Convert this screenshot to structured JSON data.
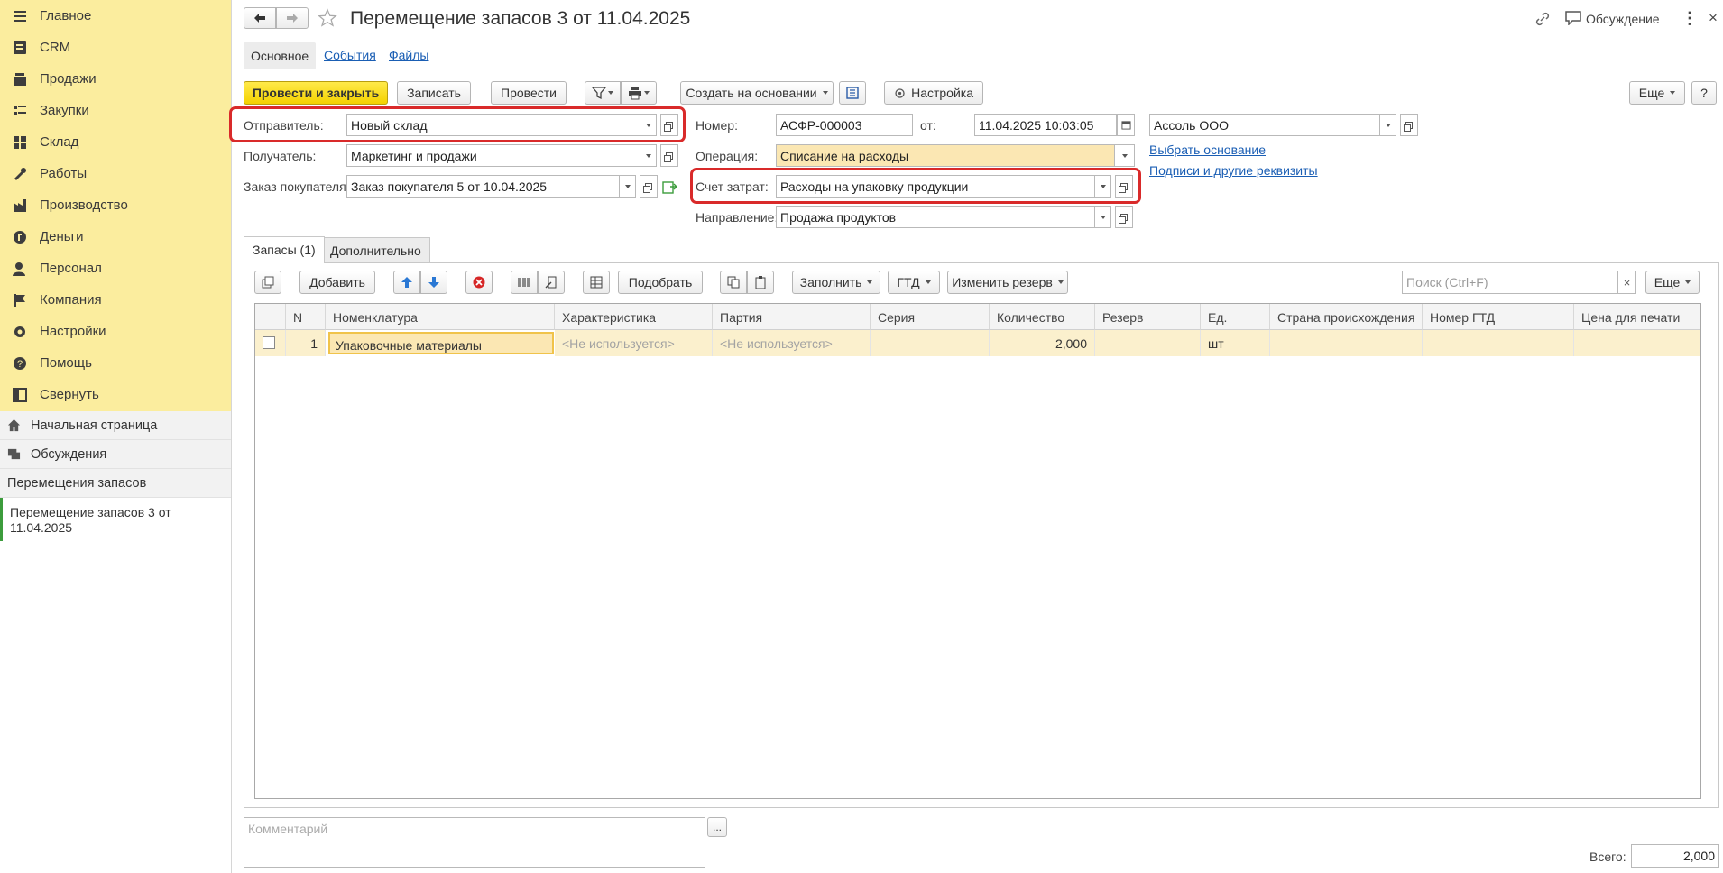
{
  "sidebar": {
    "menu": [
      {
        "label": "Главное",
        "icon": "hamburger-icon"
      },
      {
        "label": "CRM",
        "icon": "crm-icon"
      },
      {
        "label": "Продажи",
        "icon": "cart-icon"
      },
      {
        "label": "Закупки",
        "icon": "purchases-icon"
      },
      {
        "label": "Склад",
        "icon": "warehouse-icon"
      },
      {
        "label": "Работы",
        "icon": "tools-icon"
      },
      {
        "label": "Производство",
        "icon": "factory-icon"
      },
      {
        "label": "Деньги",
        "icon": "money-icon"
      },
      {
        "label": "Персонал",
        "icon": "person-icon"
      },
      {
        "label": "Компания",
        "icon": "flag-icon"
      },
      {
        "label": "Настройки",
        "icon": "gear-icon"
      },
      {
        "label": "Помощь",
        "icon": "help-icon"
      },
      {
        "label": "Свернуть",
        "icon": "collapse-icon"
      }
    ],
    "home": "Начальная страница",
    "discussions": "Обсуждения",
    "section": "Перемещения запасов",
    "current_doc": "Перемещение запасов 3 от 11.04.2025"
  },
  "header": {
    "title": "Перемещение запасов 3 от 11.04.2025",
    "discussion": "Обсуждение"
  },
  "tabs_top": [
    "Основное",
    "События",
    "Файлы"
  ],
  "toolbar": {
    "post_close": "Провести и закрыть",
    "save": "Записать",
    "post": "Провести",
    "create_based": "Создать на основании",
    "settings": "Настройка",
    "more": "Еще",
    "help": "?"
  },
  "form": {
    "sender_label": "Отправитель:",
    "sender": "Новый склад",
    "recipient_label": "Получатель:",
    "recipient": "Маркетинг и продажи",
    "order_label": "Заказ покупателя:",
    "order": "Заказ покупателя 5 от 10.04.2025",
    "number_label": "Номер:",
    "number": "АСФР-000003",
    "from_label": "от:",
    "date": "11.04.2025 10:03:05",
    "company": "Ассоль ООО",
    "operation_label": "Операция:",
    "operation": "Списание на расходы",
    "account_label": "Счет затрат:",
    "account": "Расходы на упаковку продукции",
    "direction_label": "Направление:",
    "direction": "Продажа продуктов",
    "link_basis": "Выбрать основание",
    "link_signatures": "Подписи и другие реквизиты"
  },
  "section_tabs": [
    "Запасы (1)",
    "Дополнительно"
  ],
  "table_toolbar": {
    "add": "Добавить",
    "pick": "Подобрать",
    "fill": "Заполнить",
    "gtd": "ГТД",
    "change_reserve": "Изменить резерв",
    "search_placeholder": "Поиск (Ctrl+F)",
    "more": "Еще"
  },
  "table": {
    "columns": [
      "N",
      "Номенклатура",
      "Характеристика",
      "Партия",
      "Серия",
      "Количество",
      "Резерв",
      "Ед.",
      "Страна происхождения",
      "Номер ГТД",
      "Цена для печати"
    ],
    "rows": [
      {
        "n": "1",
        "item": "Упаковочные материалы",
        "characteristic": "<Не используется>",
        "batch": "<Не используется>",
        "series": "",
        "qty": "2,000",
        "reserve": "",
        "unit": "шт",
        "country": "",
        "gtd": "",
        "price": ""
      }
    ]
  },
  "footer": {
    "comment_placeholder": "Комментарий",
    "total_label": "Всего:",
    "total": "2,000"
  }
}
